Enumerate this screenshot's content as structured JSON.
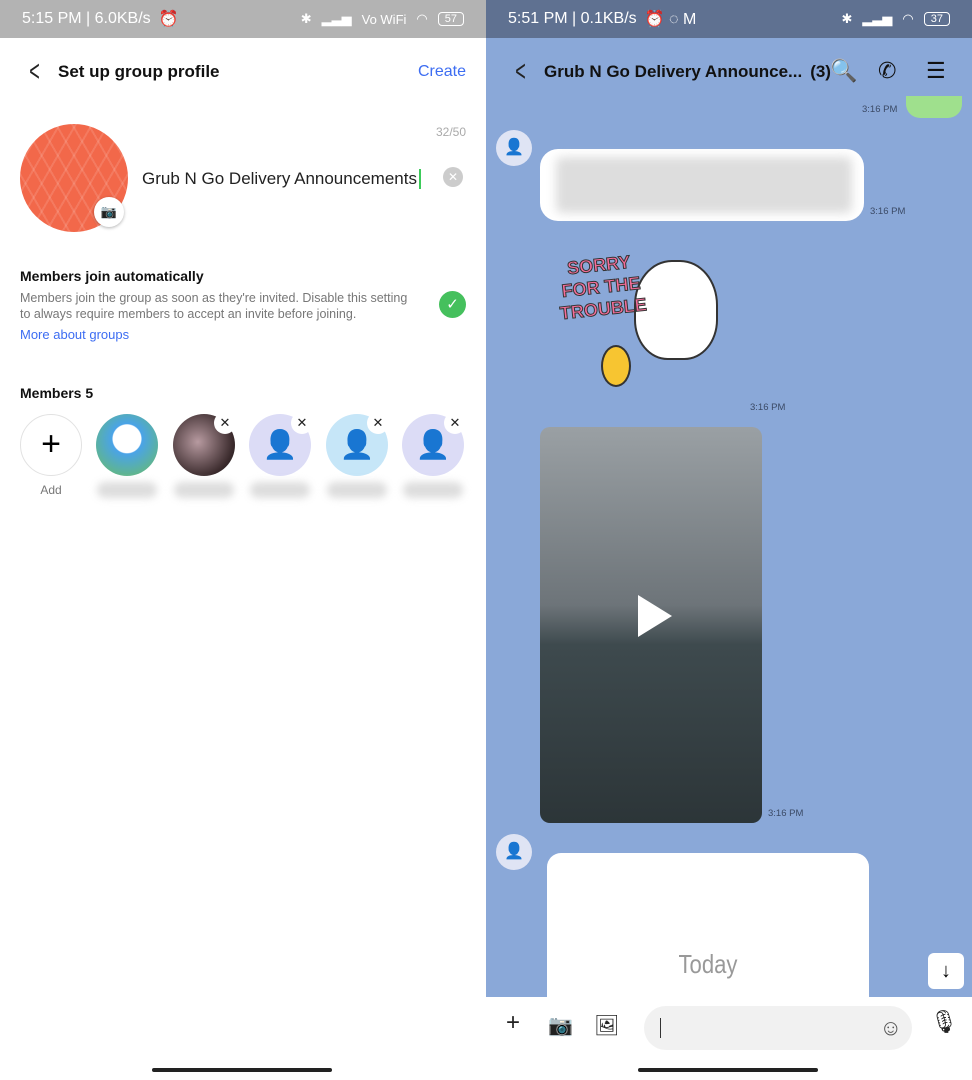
{
  "left": {
    "status": {
      "time_net": "5:15 PM | 6.0KB/s",
      "network": "Vo WiFi",
      "battery": "57"
    },
    "header": {
      "title": "Set up group profile",
      "create_label": "Create"
    },
    "profile": {
      "char_count": "32/50",
      "group_name": "Grub N Go Delivery Announcements"
    },
    "auto_join": {
      "title": "Members join automatically",
      "description": "Members join the group as soon as they're invited. Disable this setting to always require members to accept an invite before joining.",
      "link": "More about groups",
      "enabled": true
    },
    "members": {
      "title": "Members 5",
      "add_label": "Add"
    }
  },
  "right": {
    "status": {
      "time_net": "5:51 PM | 0.1KB/s",
      "battery": "37"
    },
    "header": {
      "title": "Grub N Go Delivery Announce...",
      "count": "(3)"
    },
    "messages": [
      {
        "time": "3:16 PM"
      },
      {
        "time": "3:16 PM"
      },
      {
        "time": "3:16 PM",
        "sticker_text": "SORRY FOR THE TROUBLE"
      },
      {
        "time": "3:16 PM"
      }
    ],
    "card_text": "Today",
    "colors": {
      "chat_bg": "#8aa8d8",
      "accent": "#3d6df2",
      "toggle": "#45c05d"
    }
  }
}
